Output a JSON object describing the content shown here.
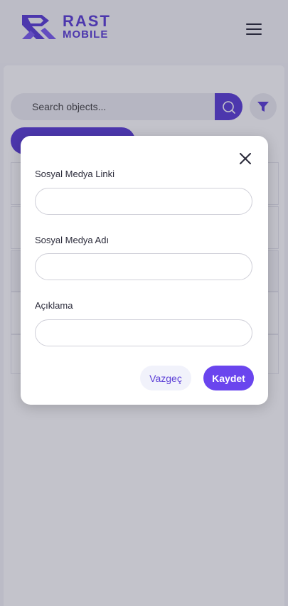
{
  "brand": {
    "name_line1": "RAST",
    "name_line2": "MOBILE",
    "color": "#5b3ed6"
  },
  "header": {
    "menu_icon": "hamburger-icon"
  },
  "toolbar": {
    "search_placeholder": "Search objects...",
    "search_icon": "search-icon",
    "filter_icon": "filter-icon",
    "accent": "#5b3ed6"
  },
  "modal": {
    "close_icon": "close-icon",
    "fields": [
      {
        "label": "Sosyal Medya Linki",
        "value": ""
      },
      {
        "label": "Sosyal Medya Adı",
        "value": ""
      },
      {
        "label": "Açıklama",
        "value": ""
      }
    ],
    "cancel_label": "Vazgeç",
    "save_label": "Kaydet"
  }
}
